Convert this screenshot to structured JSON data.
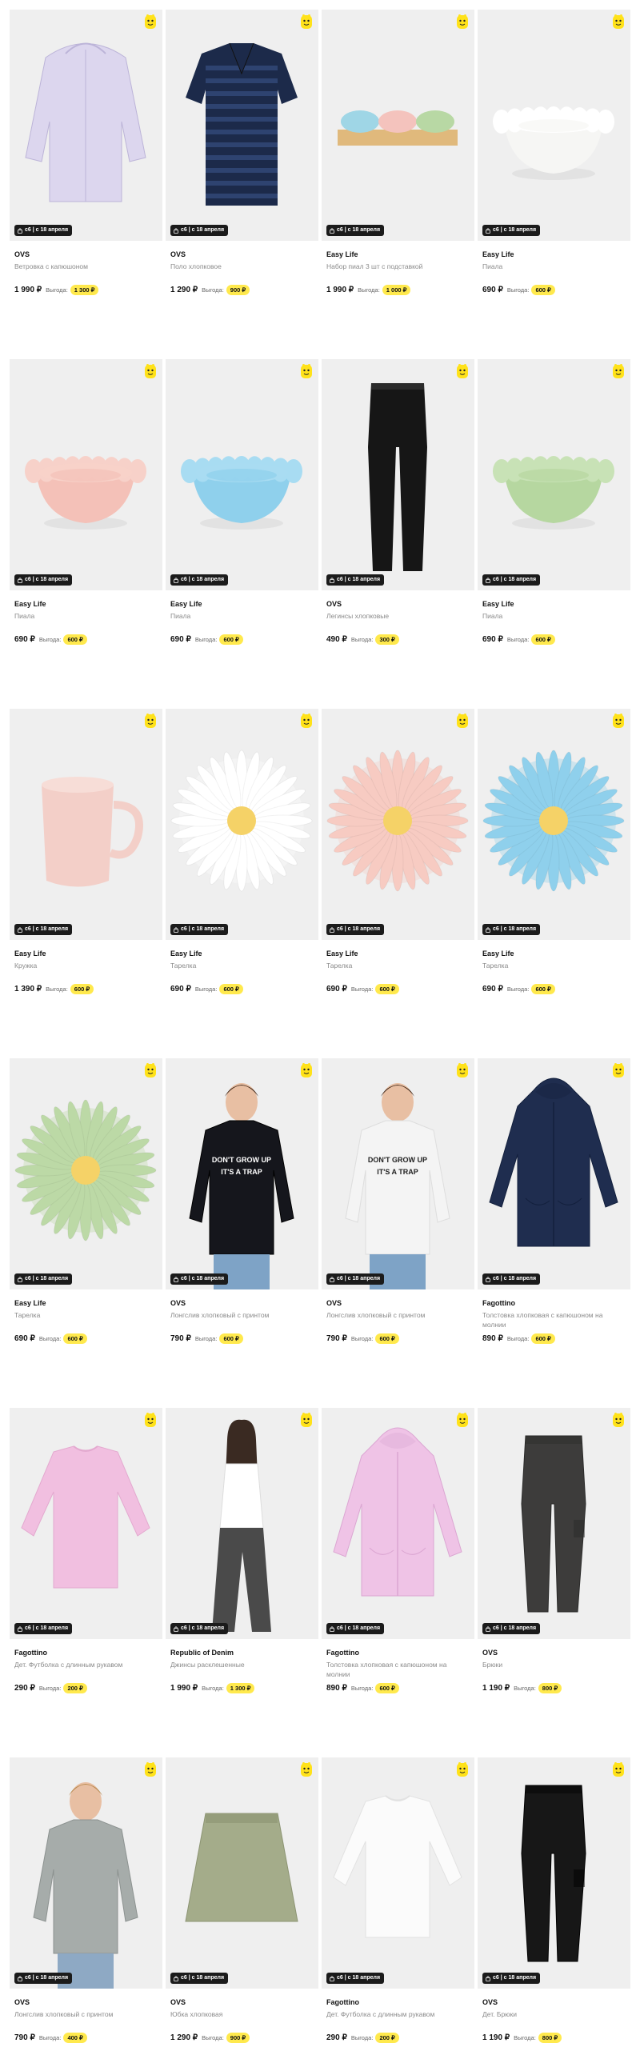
{
  "colors": {
    "badge_bg": "#1b1b1b",
    "savings_pill": "#ffe94d",
    "promo_icon": "#ffe21a"
  },
  "products": [
    {
      "brand": "OVS",
      "name": "Ветровка с капюшоном",
      "price": "1 990 ₽",
      "savings_label": "Выгода:",
      "savings": "1 300 ₽",
      "badge": "с6 | с 18 апреля",
      "image": "lavender-windbreaker",
      "promo_icon": "promo-character-icon"
    },
    {
      "brand": "OVS",
      "name": "Поло хлопковое",
      "price": "1 290 ₽",
      "savings_label": "Выгода:",
      "savings": "900 ₽",
      "badge": "с6 | с 18 апреля",
      "image": "navy-striped-polo",
      "promo_icon": "promo-character-icon"
    },
    {
      "brand": "Easy Life",
      "name": "Набор пиал 3 шт с подставкой",
      "price": "1 990 ₽",
      "savings_label": "Выгода:",
      "savings": "1 000 ₽",
      "badge": "с6 | с 18 апреля",
      "image": "three-bowls-tray",
      "promo_icon": "promo-character-icon"
    },
    {
      "brand": "Easy Life",
      "name": "Пиала",
      "price": "690 ₽",
      "savings_label": "Выгода:",
      "savings": "600 ₽",
      "badge": "с6 | с 18 апреля",
      "image": "white-flower-bowl",
      "promo_icon": "promo-character-icon"
    },
    {
      "brand": "Easy Life",
      "name": "Пиала",
      "price": "690 ₽",
      "savings_label": "Выгода:",
      "savings": "600 ₽",
      "badge": "с6 | с 18 апреля",
      "image": "pink-flower-bowl",
      "promo_icon": "promo-character-icon"
    },
    {
      "brand": "Easy Life",
      "name": "Пиала",
      "price": "690 ₽",
      "savings_label": "Выгода:",
      "savings": "600 ₽",
      "badge": "с6 | с 18 апреля",
      "image": "blue-flower-bowl",
      "promo_icon": "promo-character-icon"
    },
    {
      "brand": "OVS",
      "name": "Легинсы хлопковые",
      "price": "490 ₽",
      "savings_label": "Выгода:",
      "savings": "300 ₽",
      "badge": "с6 | с 18 апреля",
      "image": "black-leggings",
      "promo_icon": "promo-character-icon"
    },
    {
      "brand": "Easy Life",
      "name": "Пиала",
      "price": "690 ₽",
      "savings_label": "Выгода:",
      "savings": "600 ₽",
      "badge": "с6 | с 18 апреля",
      "image": "green-flower-bowl",
      "promo_icon": "promo-character-icon"
    },
    {
      "brand": "Easy Life",
      "name": "Кружка",
      "price": "1 390 ₽",
      "savings_label": "Выгода:",
      "savings": "600 ₽",
      "badge": "с6 | с 18 апреля",
      "image": "pink-mug",
      "promo_icon": "promo-character-icon"
    },
    {
      "brand": "Easy Life",
      "name": "Тарелка",
      "price": "690 ₽",
      "savings_label": "Выгода:",
      "savings": "600 ₽",
      "badge": "с6 | с 18 апреля",
      "image": "white-daisy-plate",
      "promo_icon": "promo-character-icon"
    },
    {
      "brand": "Easy Life",
      "name": "Тарелка",
      "price": "690 ₽",
      "savings_label": "Выгода:",
      "savings": "600 ₽",
      "badge": "с6 | с 18 апреля",
      "image": "pink-daisy-plate",
      "promo_icon": "promo-character-icon"
    },
    {
      "brand": "Easy Life",
      "name": "Тарелка",
      "price": "690 ₽",
      "savings_label": "Выгода:",
      "savings": "600 ₽",
      "badge": "с6 | с 18 апреля",
      "image": "blue-daisy-plate",
      "promo_icon": "promo-character-icon"
    },
    {
      "brand": "Easy Life",
      "name": "Тарелка",
      "price": "690 ₽",
      "savings_label": "Выгода:",
      "savings": "600 ₽",
      "badge": "с6 | с 18 апреля",
      "image": "green-daisy-plate",
      "promo_icon": "promo-character-icon"
    },
    {
      "brand": "OVS",
      "name": "Лонгслив хлопковый с принтом",
      "price": "790 ₽",
      "savings_label": "Выгода:",
      "savings": "600 ₽",
      "badge": "с6 | с 18 апреля",
      "image": "black-longsleeve-print",
      "promo_icon": "promo-character-icon",
      "print_text": [
        "DON'T GROW UP",
        "IT'S A TRAP"
      ]
    },
    {
      "brand": "OVS",
      "name": "Лонгслив хлопковый с принтом",
      "price": "790 ₽",
      "savings_label": "Выгода:",
      "savings": "600 ₽",
      "badge": "с6 | с 18 апреля",
      "image": "white-longsleeve-print",
      "promo_icon": "promo-character-icon",
      "print_text": [
        "DON'T GROW UP",
        "IT'S A TRAP"
      ]
    },
    {
      "brand": "Fagottino",
      "name": "Толстовка хлопковая с капюшоном на молнии",
      "price": "890 ₽",
      "savings_label": "Выгода:",
      "savings": "600 ₽",
      "badge": "с6 | с 18 апреля",
      "image": "navy-zip-hoodie",
      "promo_icon": "promo-character-icon"
    },
    {
      "brand": "Fagottino",
      "name": "Дет. Футболка с длинным рукавом",
      "price": "290 ₽",
      "savings_label": "Выгода:",
      "savings": "200 ₽",
      "badge": "с6 | с 18 апреля",
      "image": "pink-longsleeve",
      "promo_icon": "promo-character-icon"
    },
    {
      "brand": "Republic of Denim",
      "name": "Джинсы расклешенные",
      "price": "1 990 ₽",
      "savings_label": "Выгода:",
      "savings": "1 300 ₽",
      "badge": "с6 | с 18 апреля",
      "image": "flared-jeans-model",
      "promo_icon": "promo-character-icon"
    },
    {
      "brand": "Fagottino",
      "name": "Толстовка хлопковая с капюшоном на молнии",
      "price": "890 ₽",
      "savings_label": "Выгода:",
      "savings": "600 ₽",
      "badge": "с6 | с 18 апреля",
      "image": "pink-zip-hoodie",
      "promo_icon": "promo-character-icon"
    },
    {
      "brand": "OVS",
      "name": "Брюки",
      "price": "1 190 ₽",
      "savings_label": "Выгода:",
      "savings": "800 ₽",
      "badge": "с6 | с 18 апреля",
      "image": "grey-joggers",
      "promo_icon": "promo-character-icon"
    },
    {
      "brand": "OVS",
      "name": "Лонгслив хлопковый с принтом",
      "price": "790 ₽",
      "savings_label": "Выгода:",
      "savings": "400 ₽",
      "badge": "с6 | с 18 апреля",
      "image": "grey-longsleeve-print",
      "promo_icon": "promo-character-icon"
    },
    {
      "brand": "OVS",
      "name": "Юбка хлопковая",
      "price": "1 290 ₽",
      "savings_label": "Выгода:",
      "savings": "900 ₽",
      "badge": "с6 | с 18 апреля",
      "image": "khaki-skirt",
      "promo_icon": "promo-character-icon"
    },
    {
      "brand": "Fagottino",
      "name": "Дет. Футболка с длинным рукавом",
      "price": "290 ₽",
      "savings_label": "Выгода:",
      "savings": "200 ₽",
      "badge": "с6 | с 18 апреля",
      "image": "white-longsleeve",
      "promo_icon": "promo-character-icon"
    },
    {
      "brand": "OVS",
      "name": "Дет. Брюки",
      "price": "1 190 ₽",
      "savings_label": "Выгода:",
      "savings": "800 ₽",
      "badge": "с6 | с 18 апреля",
      "image": "black-joggers",
      "promo_icon": "promo-character-icon"
    }
  ]
}
